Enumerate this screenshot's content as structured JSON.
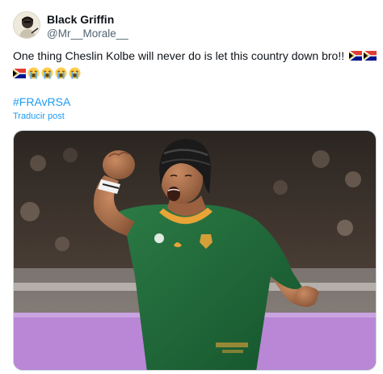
{
  "author": {
    "display_name": "Black Griffin",
    "handle": "@Mr__Morale__",
    "avatar_icon": "avatar-illustration-icon"
  },
  "tweet": {
    "text": "One thing Cheslin Kolbe will never do is let this country down bro!!",
    "trailing_emojis": [
      "south-africa-flag-icon",
      "south-africa-flag-icon"
    ],
    "second_line_emojis": [
      "south-africa-flag-icon",
      "loudly-crying-face-icon",
      "loudly-crying-face-icon",
      "loudly-crying-face-icon",
      "loudly-crying-face-icon"
    ],
    "hashtag": "#FRAvRSA",
    "translate_link": "Traducir post"
  },
  "media": {
    "type": "photo",
    "subject": "rugby player celebrating with raised fist in green jersey and headgear"
  },
  "colors": {
    "link_blue": "#1d9bf0",
    "text_primary": "#0f1419",
    "text_secondary": "#536471",
    "jersey_green": "#1e6b3a",
    "jersey_gold": "#e8a437",
    "pitch_band": "#b987d6"
  }
}
